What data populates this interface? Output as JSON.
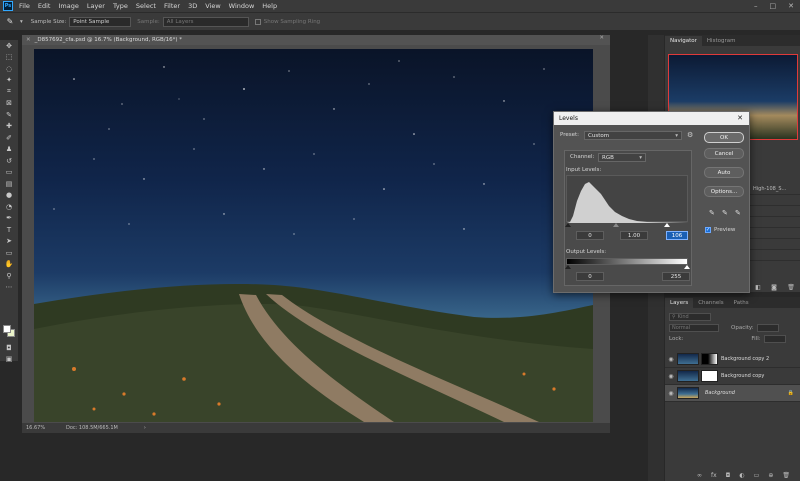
{
  "menu": [
    "File",
    "Edit",
    "Image",
    "Layer",
    "Type",
    "Select",
    "Filter",
    "3D",
    "View",
    "Window",
    "Help"
  ],
  "options_bar": {
    "sample_size_label": "Sample Size:",
    "sample_size_value": "Point Sample",
    "sample_label": "Sample:",
    "sample_value": "All Layers",
    "show_ring_label": "Show Sampling Ring"
  },
  "document": {
    "tab_title": "_D857692_cfa.psd @ 16.7% (Background, RGB/16*) *",
    "zoom": "16.67%",
    "doc_info": "Doc: 108.5M/665.1M"
  },
  "navigator": {
    "tabs": [
      "Navigator",
      "Histogram"
    ]
  },
  "history": {
    "item": "High-108_S..."
  },
  "layers": {
    "tabs": [
      "Layers",
      "Channels",
      "Paths"
    ],
    "filter_placeholder": "Kind",
    "blend_mode": "Normal",
    "opacity_label": "Opacity:",
    "lock_label": "Lock:",
    "fill_label": "Fill:",
    "items": [
      {
        "name": "Background copy 2"
      },
      {
        "name": "Background copy"
      },
      {
        "name": "Background"
      }
    ]
  },
  "levels": {
    "title": "Levels",
    "preset_label": "Preset:",
    "preset_value": "Custom",
    "channel_label": "Channel:",
    "channel_value": "RGB",
    "input_label": "Input Levels:",
    "input_black": "0",
    "input_gamma": "1.00",
    "input_white": "106",
    "output_label": "Output Levels:",
    "output_black": "0",
    "output_white": "255",
    "buttons": {
      "ok": "OK",
      "cancel": "Cancel",
      "auto": "Auto",
      "options": "Options..."
    },
    "preview_label": "Preview"
  },
  "colors": {
    "accent": "#31a8ff",
    "selection_focus": "#1a5fb4"
  }
}
